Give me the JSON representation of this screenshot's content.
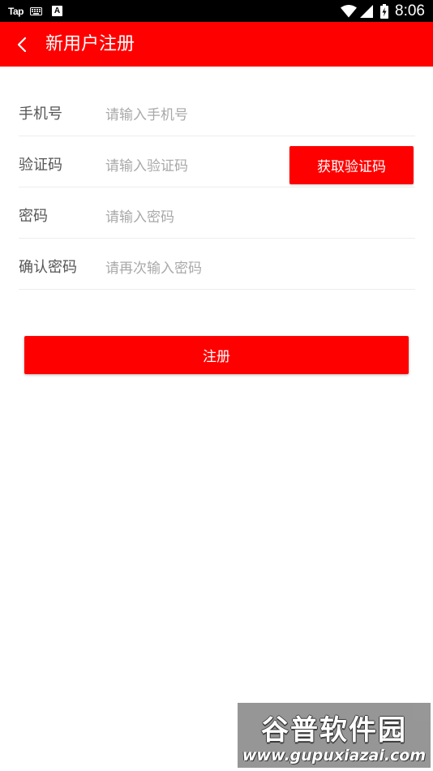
{
  "status_bar": {
    "app_name": "Tap",
    "input_method_letter": "A",
    "time": "8:06",
    "icons": [
      "keyboard-icon",
      "wifi-icon",
      "cell-signal-icon",
      "battery-charging-icon"
    ]
  },
  "header": {
    "back_icon": "chevron-left-icon",
    "title": "新用户注册",
    "background_color": "#ff0000"
  },
  "form": {
    "phone": {
      "label": "手机号",
      "placeholder": "请输入手机号",
      "value": ""
    },
    "code": {
      "label": "验证码",
      "placeholder": "请输入验证码",
      "value": "",
      "button_label": "获取验证码"
    },
    "password": {
      "label": "密码",
      "placeholder": "请输入密码",
      "value": ""
    },
    "confirm_password": {
      "label": "确认密码",
      "placeholder": "请再次输入密码",
      "value": ""
    }
  },
  "register_button": {
    "label": "注册"
  },
  "watermark": {
    "name": "谷普软件园",
    "url": "www.gupuxiazai.com"
  },
  "colors": {
    "accent": "#ff0000",
    "label_text": "#555555",
    "placeholder_text": "#a9a9a9",
    "divider": "#ededed"
  }
}
